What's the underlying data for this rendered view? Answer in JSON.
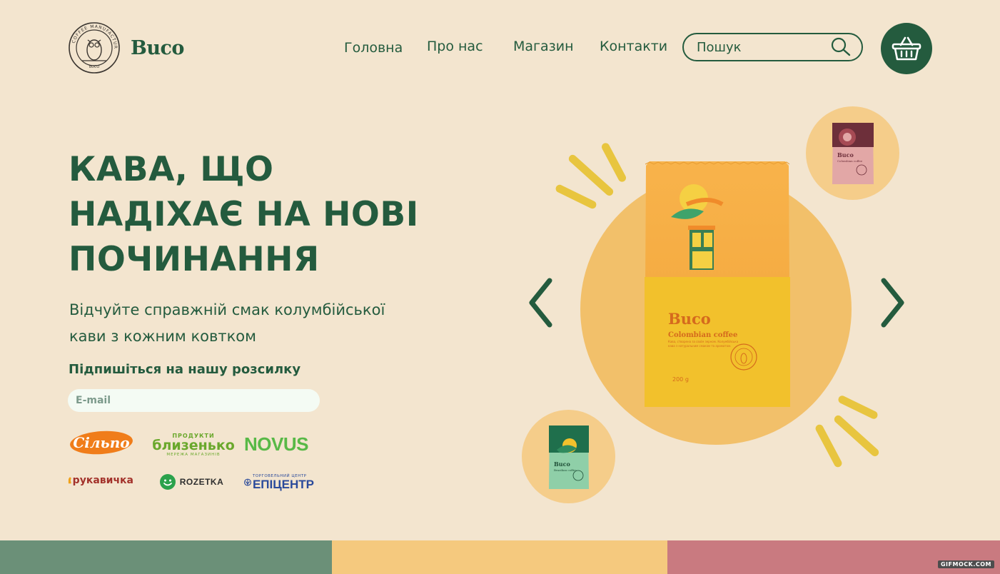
{
  "brand": {
    "name": "Buco",
    "seal_text": "COFFEE MANUFACTURE",
    "seal_bottom": "BUCO"
  },
  "nav": {
    "items": [
      "Головна",
      "Про нас",
      "Магазин",
      "Контакти"
    ]
  },
  "search": {
    "placeholder": "Пошук",
    "icon": "search-icon"
  },
  "cart": {
    "icon": "basket-icon"
  },
  "hero": {
    "headline_lines": [
      "КАВА, ЩО",
      "НАДІХАЄ НА НОВІ",
      "ПОЧИНАННЯ"
    ],
    "subtext_lines": [
      "Відчуйте справжній смак колумбійської",
      "кави з кожним ковтком"
    ],
    "subscribe_label": "Підпишіться на нашу розсилку",
    "email_placeholder": "E-mail"
  },
  "partners": [
    {
      "name": "Сільпо",
      "color": "#f07d1a"
    },
    {
      "name": "близенько",
      "top": "ПРОДУКТИ",
      "bottom": "МЕРЕЖА МАГАЗИНІВ",
      "color": "#6aa82c"
    },
    {
      "name": "NOVUS",
      "color": "#58b947"
    },
    {
      "name": "рукавичка",
      "color": "#a3322b"
    },
    {
      "name": "ROZETKA",
      "color": "#2e2e2e"
    },
    {
      "name": "ЕПІЦЕНТР",
      "top": "ТОРГОВЕЛЬНИЙ ЦЕНТР",
      "color": "#2a4a9b"
    }
  ],
  "product": {
    "brand": "Buco",
    "variant": "Colombian coffee",
    "description": "Кава, створена за своїм зерном. Колумбійська кава з натуральним смаком та ароматом.",
    "weight": "200 g",
    "thumb_top_variant": "Colombian coffee",
    "thumb_bottom_variant": "Brazilian coffee"
  },
  "carousel": {
    "prev_icon": "chevron-left-icon",
    "next_icon": "chevron-right-icon"
  },
  "colors": {
    "background": "#f3e5cf",
    "primary": "#245b3e",
    "accent_yellow": "#e8c53f",
    "circle": "#f2c06a",
    "bar_green": "#6b9078",
    "bar_yellow": "#f5c97e",
    "bar_pink": "#c97a80"
  },
  "watermark": "GIFMOCK.COM"
}
